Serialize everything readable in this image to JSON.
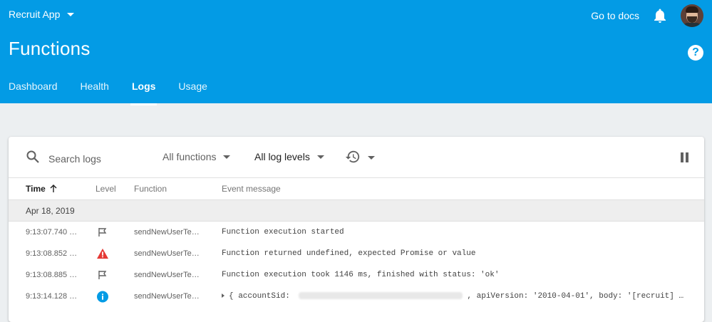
{
  "header": {
    "project_name": "Recruit App",
    "docs_link": "Go to docs",
    "page_title": "Functions",
    "help_label": "?",
    "tabs": [
      {
        "label": "Dashboard"
      },
      {
        "label": "Health"
      },
      {
        "label": "Logs"
      },
      {
        "label": "Usage"
      }
    ],
    "active_tab": "Logs"
  },
  "toolbar": {
    "search_placeholder": "Search logs",
    "functions_filter": "All functions",
    "levels_filter": "All log levels"
  },
  "table": {
    "columns": {
      "time": "Time",
      "level": "Level",
      "function": "Function",
      "message": "Event message"
    },
    "date_group": "Apr 18, 2019",
    "rows": [
      {
        "time": "9:13:07.740 …",
        "level_icon": "flag-icon",
        "function": "sendNewUserTe…",
        "message": "Function execution started"
      },
      {
        "time": "9:13:08.852 …",
        "level_icon": "warning-icon",
        "function": "sendNewUserTe…",
        "message": "Function returned undefined, expected Promise or value"
      },
      {
        "time": "9:13:08.885 …",
        "level_icon": "flag-icon",
        "function": "sendNewUserTe…",
        "message": "Function execution took 1146 ms, finished with status: 'ok'"
      },
      {
        "time": "9:13:14.128 …",
        "level_icon": "info-icon",
        "function": "sendNewUserTe…",
        "message_prefix": "{ accountSid: ",
        "message_suffix": ", apiVersion: '2010-04-01', body: '[recruit] …"
      }
    ]
  },
  "colors": {
    "header_bg": "#039be5",
    "page_bg": "#eceff1",
    "warning": "#e53935",
    "info": "#039be5"
  }
}
